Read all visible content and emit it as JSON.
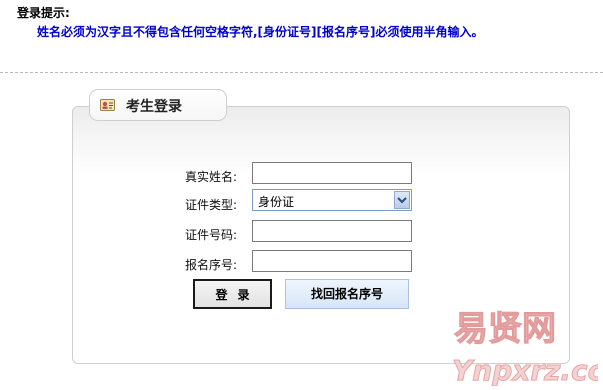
{
  "tip": {
    "title": "登录提示:",
    "text": "姓名必须为汉字且不得包含任何空格字符,[身份证号][报名序号]必须使用半角输入。"
  },
  "panel": {
    "title": "考生登录"
  },
  "form": {
    "name_label": "真实姓名:",
    "name_value": "",
    "id_type_label": "证件类型:",
    "id_type_selected": "身份证",
    "id_number_label": "证件号码:",
    "id_number_value": "",
    "reg_number_label": "报名序号:",
    "reg_number_value": ""
  },
  "buttons": {
    "login": "登录",
    "find_reg_number": "找回报名序号"
  },
  "watermark": {
    "chinese": "易贤网",
    "latin": "Ynpxrz.com"
  },
  "colors": {
    "tip_text": "#0000cc",
    "watermark": "#e8a0a0"
  }
}
